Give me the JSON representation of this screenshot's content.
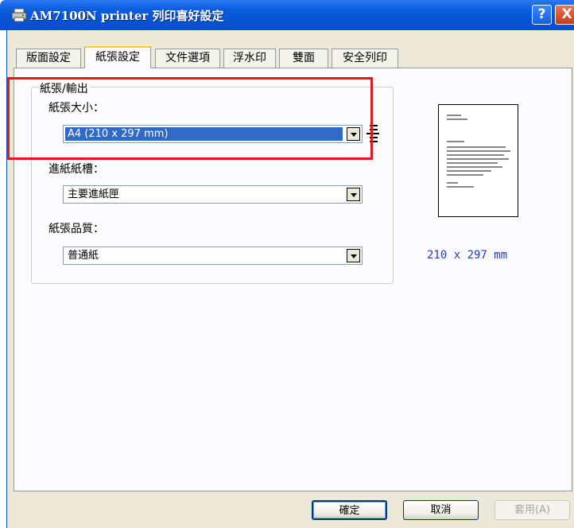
{
  "window": {
    "title": "AM7100N printer 列印喜好設定"
  },
  "title_buttons": {
    "help": "?",
    "close": "X"
  },
  "tabs": [
    {
      "label": "版面設定",
      "active": false
    },
    {
      "label": "紙張設定",
      "active": true
    },
    {
      "label": "文件選項",
      "active": false
    },
    {
      "label": "浮水印",
      "active": false
    },
    {
      "label": "雙面",
      "active": false
    },
    {
      "label": "安全列印",
      "active": false
    }
  ],
  "group": {
    "title": "紙張/輸出"
  },
  "paper_size": {
    "label": "紙張大小：",
    "value": "A4 (210 x 297 mm)"
  },
  "paper_source": {
    "label": "進紙紙槽：",
    "value": "主要進紙匣"
  },
  "paper_quality": {
    "label": "紙張品質：",
    "value": "普通紙"
  },
  "preview": {
    "size_text": "210 x 297 mm"
  },
  "buttons": {
    "ok": "確定",
    "cancel": "取消",
    "apply": "套用(A)"
  },
  "colors": {
    "titlebar": "#0554d4",
    "selection": "#316ac5",
    "highlight": "#e0191d",
    "size_text": "#1e3fb4"
  },
  "icons": {
    "title": "printer-icon",
    "paper_size_list": "list-icon"
  }
}
